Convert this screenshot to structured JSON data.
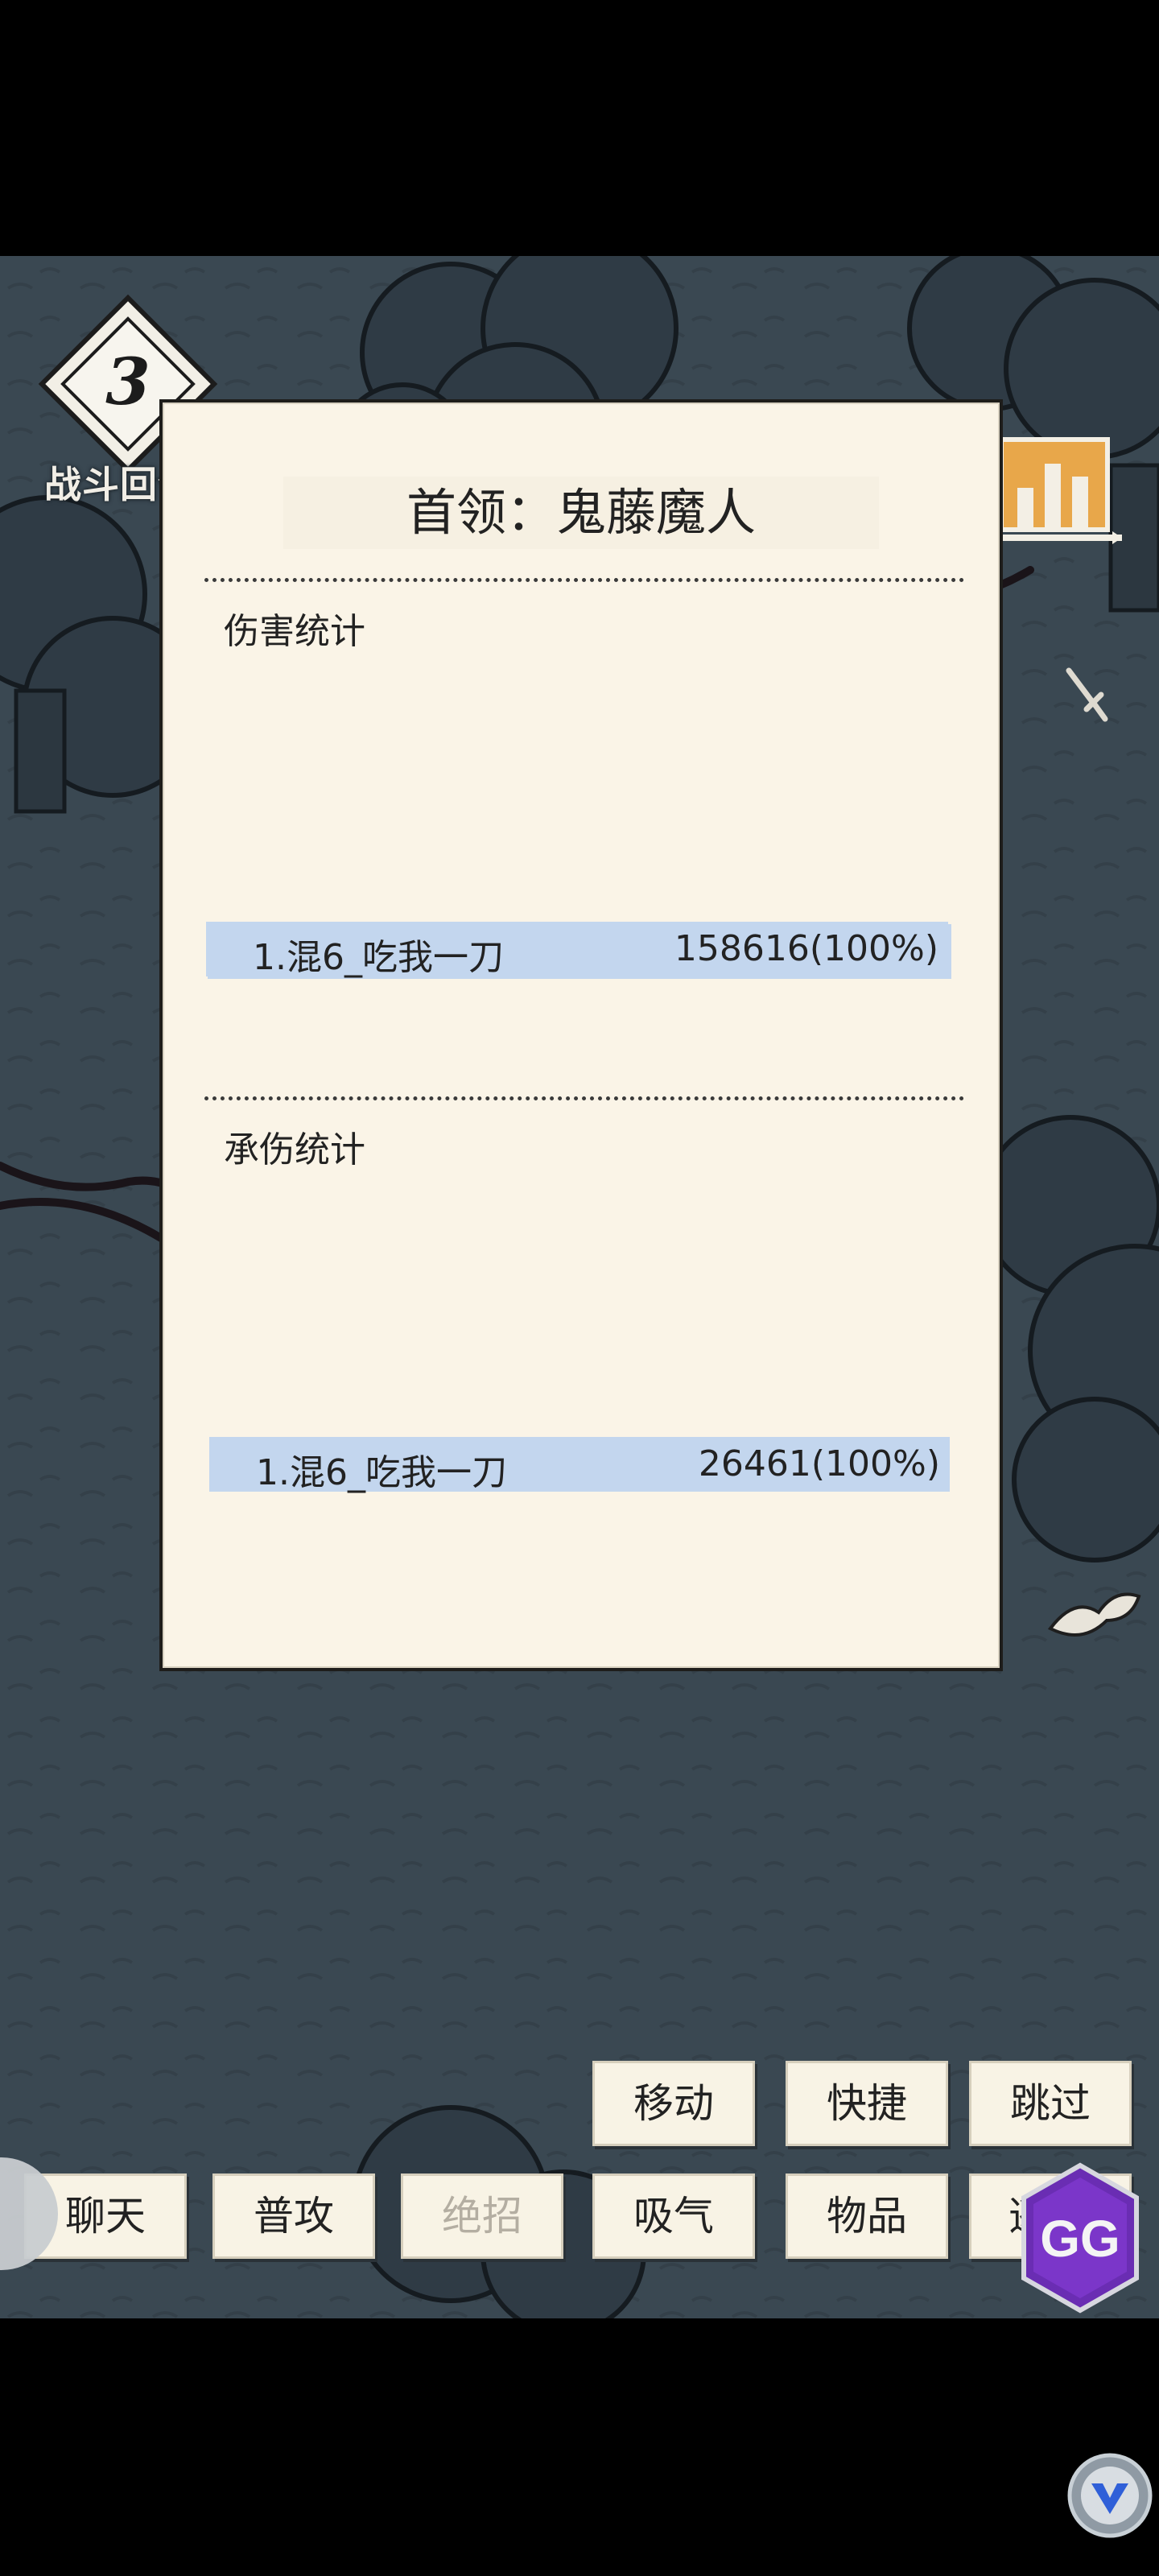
{
  "round": {
    "number": "3",
    "label": "战斗回合"
  },
  "turn_marker": "1",
  "panel": {
    "title": "首领：鬼藤魔人",
    "damage": {
      "label": "伤害统计",
      "rows": [
        {
          "name": "1.混6_吃我一刀",
          "value": "158616(100%)"
        }
      ]
    },
    "taken": {
      "label": "承伤统计",
      "rows": [
        {
          "name": "1.混6_吃我一刀",
          "value": "26461(100%)"
        }
      ]
    }
  },
  "actions_top": {
    "move": "移动",
    "quick": "快捷",
    "skip": "跳过"
  },
  "actions_bottom": {
    "chat": "聊天",
    "attack": "普攻",
    "ultimate": "绝招",
    "breathe": "吸气",
    "items": "物品",
    "escape": "逃"
  },
  "overlay": {
    "gg": "GG"
  },
  "colors": {
    "panel_bg": "#faf4e7",
    "row_highlight": "#c3d6ee",
    "game_bg": "#3a4852"
  },
  "icons": [
    "round-diamond-icon",
    "stats-chart-icon",
    "sword-icon",
    "leaf-icon",
    "gg-icon",
    "v-icon"
  ]
}
